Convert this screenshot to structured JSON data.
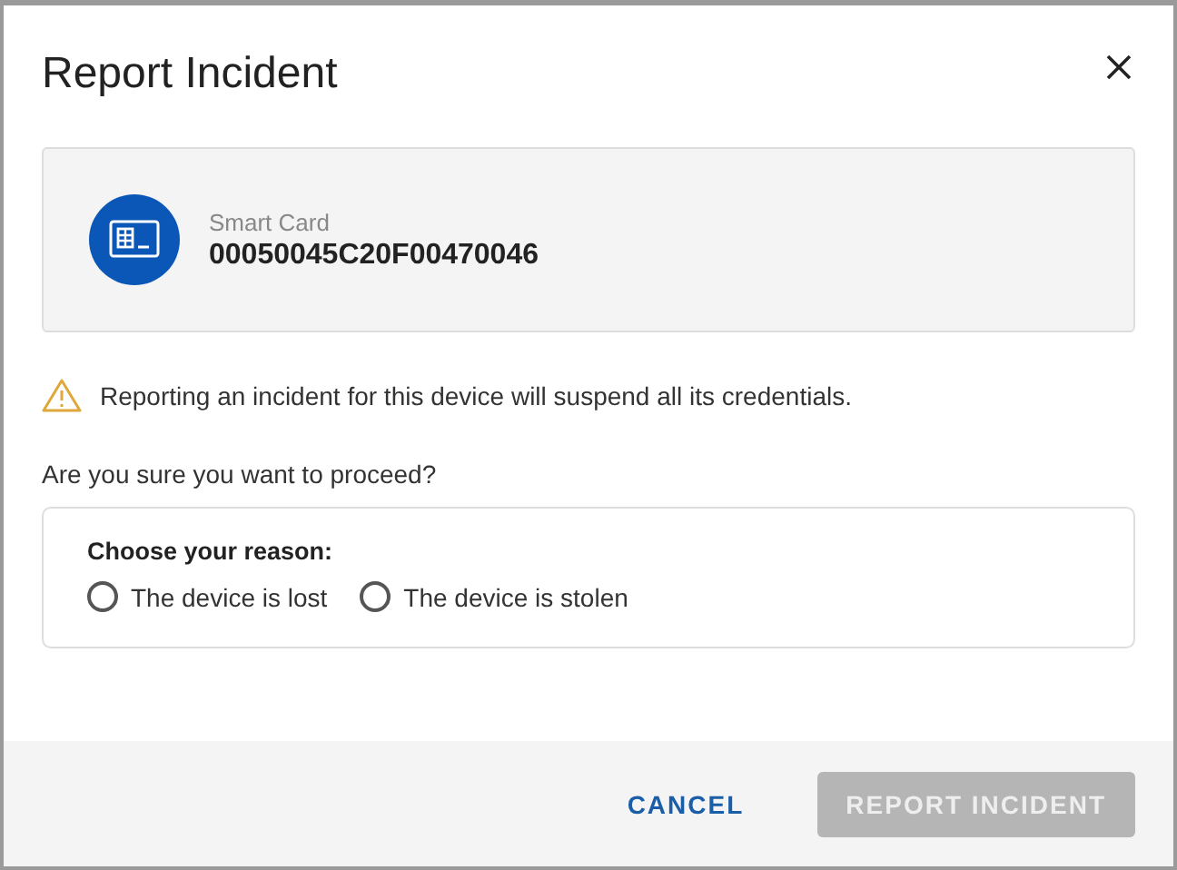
{
  "dialog": {
    "title": "Report Incident"
  },
  "device": {
    "type": "Smart Card",
    "id": "00050045C20F00470046"
  },
  "warning": "Reporting an incident for this device will suspend all its credentials.",
  "question": "Are you sure you want to proceed?",
  "reason": {
    "label": "Choose your reason:",
    "options": [
      {
        "label": "The device is lost",
        "selected": false
      },
      {
        "label": "The device is stolen",
        "selected": false
      }
    ]
  },
  "buttons": [
    {
      "label": "CANCEL",
      "kind": "text",
      "disabled": false
    },
    {
      "label": "REPORT INCIDENT",
      "kind": "primary",
      "disabled": true
    }
  ]
}
